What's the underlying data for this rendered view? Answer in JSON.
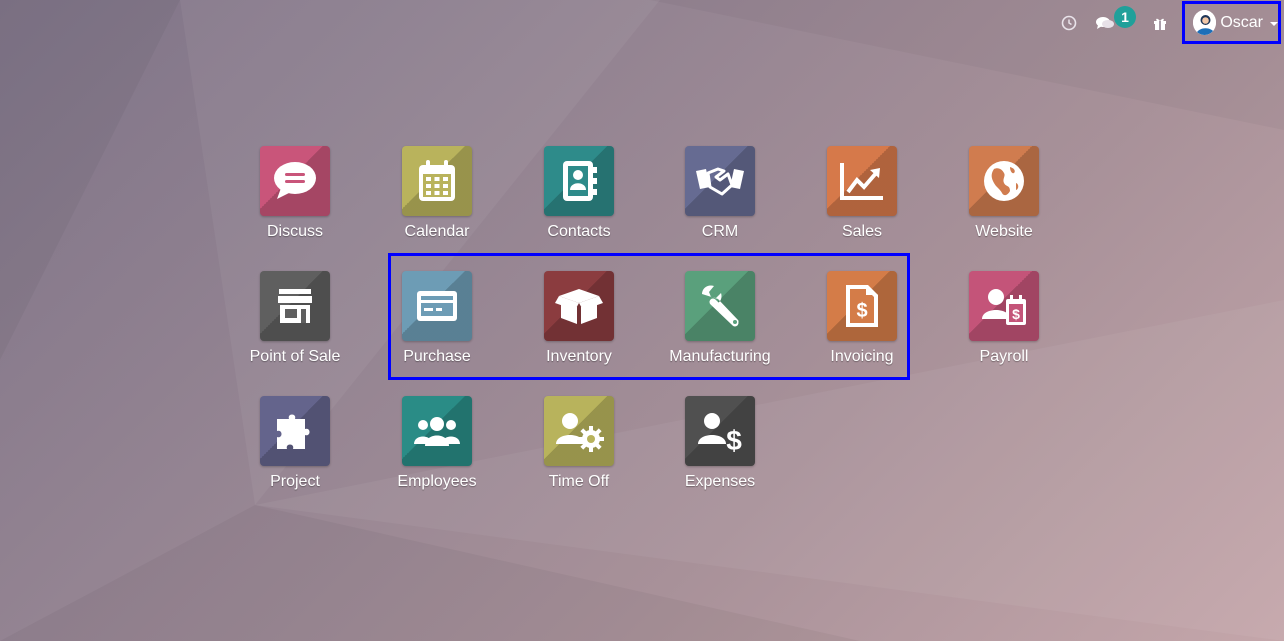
{
  "topbar": {
    "activity_icon": "clock-icon",
    "messages_icon": "chat-bubbles-icon",
    "messages_count": "1",
    "gift_icon": "gift-icon",
    "user": {
      "name": "Oscar",
      "avatar_icon": "user-avatar-icon",
      "dropdown_icon": "caret-down-icon"
    }
  },
  "apps": [
    {
      "label": "Discuss",
      "icon": "chat-bubble-icon",
      "color": "#c9557a"
    },
    {
      "label": "Calendar",
      "icon": "calendar-icon",
      "color": "#b9b35c"
    },
    {
      "label": "Contacts",
      "icon": "address-book-icon",
      "color": "#2e8b8a"
    },
    {
      "label": "CRM",
      "icon": "handshake-icon",
      "color": "#666b92"
    },
    {
      "label": "Sales",
      "icon": "line-chart-icon",
      "color": "#d6794a"
    },
    {
      "label": "Website",
      "icon": "globe-icon",
      "color": "#d07c4f"
    },
    {
      "label": "Point of Sale",
      "icon": "store-icon",
      "color": "#5f5f5f"
    },
    {
      "label": "Purchase",
      "icon": "credit-card-icon",
      "color": "#6d9cb5"
    },
    {
      "label": "Inventory",
      "icon": "box-icon",
      "color": "#8b3c3f"
    },
    {
      "label": "Manufacturing",
      "icon": "wrench-icon",
      "color": "#5aa07c"
    },
    {
      "label": "Invoicing",
      "icon": "invoice-dollar-icon",
      "color": "#d47c48"
    },
    {
      "label": "Payroll",
      "icon": "user-payroll-icon",
      "color": "#c45479"
    },
    {
      "label": "Project",
      "icon": "puzzle-icon",
      "color": "#64648c"
    },
    {
      "label": "Employees",
      "icon": "users-icon",
      "color": "#2a8c86"
    },
    {
      "label": "Time Off",
      "icon": "user-gear-icon",
      "color": "#b8b35c"
    },
    {
      "label": "Expenses",
      "icon": "user-dollar-icon",
      "color": "#505050"
    }
  ]
}
